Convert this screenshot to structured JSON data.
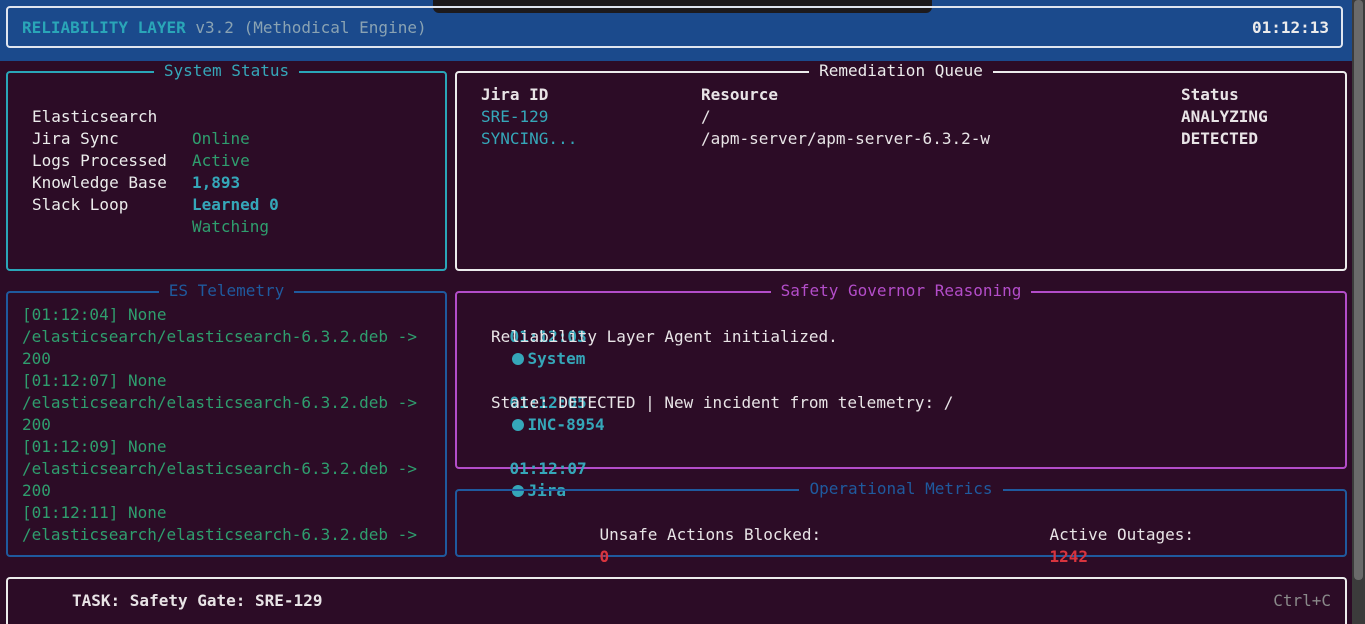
{
  "colors": {
    "background": "#2c0c26",
    "header_bg": "#1b4a8c",
    "cyan_accent": "#35a7b9",
    "green_value": "#2f9e6e",
    "red_value": "#d8343e",
    "magenta_panel": "#b34dc9",
    "blue_panel": "#1f5a9e"
  },
  "header": {
    "app_name": "RELIABILITY LAYER",
    "version": "v3.2 (Methodical Engine)",
    "clock": "01:12:13"
  },
  "system_status": {
    "title": "System Status",
    "rows": [
      {
        "label": "Elasticsearch",
        "value": "Online"
      },
      {
        "label": "Jira Sync",
        "value": "Active"
      },
      {
        "label": "Logs Processed",
        "value": "1,893"
      },
      {
        "label": "Knowledge Base",
        "value": "Learned 0"
      },
      {
        "label": "Slack Loop",
        "value": "Watching"
      }
    ]
  },
  "remediation_queue": {
    "title": "Remediation Queue",
    "headers": {
      "jira_id": "Jira ID",
      "resource": "Resource",
      "status": "Status"
    },
    "rows": [
      {
        "jira_id": "SRE-129",
        "resource": "/",
        "status": "ANALYZING"
      },
      {
        "jira_id": "SYNCING...",
        "resource": "/apm-server/apm-server-6.3.2-w",
        "status": "DETECTED"
      }
    ]
  },
  "es_telemetry": {
    "title": "ES Telemetry",
    "lines": [
      "[01:12:04] None",
      "/elasticsearch/elasticsearch-6.3.2.deb ->",
      "200",
      "[01:12:07] None",
      "/elasticsearch/elasticsearch-6.3.2.deb ->",
      "200",
      "[01:12:09] None",
      "/elasticsearch/elasticsearch-6.3.2.deb ->",
      "200",
      "[01:12:11] None",
      "/elasticsearch/elasticsearch-6.3.2.deb ->"
    ]
  },
  "safety_governor": {
    "title": "Safety Governor Reasoning",
    "entries": [
      {
        "time": "01:12:03",
        "source": "System",
        "message": "Reliability Layer Agent initialized."
      },
      {
        "time": "01:12:05",
        "source": "INC-8954",
        "message": "State: DETECTED | New incident from telemetry: /"
      },
      {
        "time": "01:12:07",
        "source": "Jira",
        "message": ""
      }
    ]
  },
  "operational_metrics": {
    "title": "Operational Metrics",
    "unsafe_label": "Unsafe Actions Blocked:",
    "unsafe_value": "0",
    "outages_label": "Active Outages:",
    "outages_value": "1242"
  },
  "task_bar": {
    "task": "TASK: Safety Gate: SRE-129",
    "shortcut": "Ctrl+C"
  }
}
